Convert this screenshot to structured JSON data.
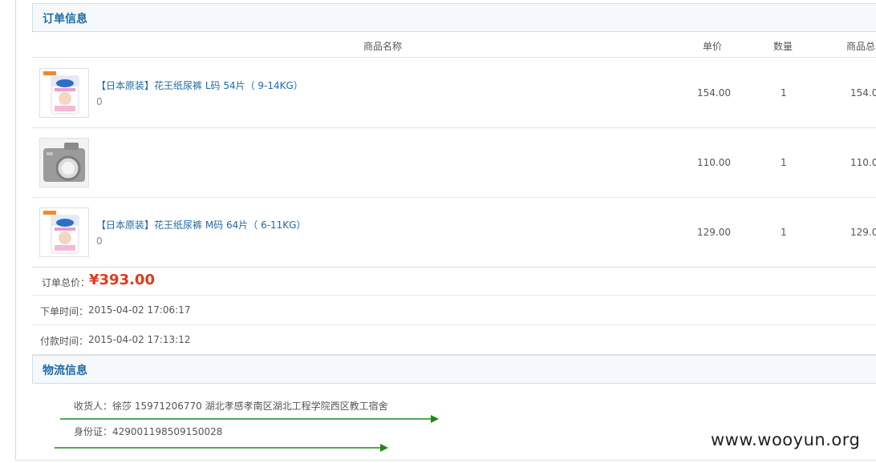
{
  "order_section": {
    "title": "订单信息"
  },
  "table_header": {
    "name": "商品名称",
    "price": "单价",
    "qty": "数量",
    "total": "商品总"
  },
  "items": [
    {
      "name": "【日本原装】花王纸尿裤 L码 54片（ 9-14KG）",
      "sub": "0",
      "price": "154.00",
      "qty": "1",
      "total": "154.0",
      "thumb": "diaper-package"
    },
    {
      "name": "",
      "sub": "",
      "price": "110.00",
      "qty": "1",
      "total": "110.0",
      "thumb": "camera-placeholder"
    },
    {
      "name": "【日本原装】花王纸尿裤 M码 64片（ 6-11KG）",
      "sub": "0",
      "price": "129.00",
      "qty": "1",
      "total": "129.0",
      "thumb": "diaper-package"
    }
  ],
  "summary": {
    "total_label": "订单总价：",
    "total_value": "¥393.00",
    "order_time_label": "下单时间：",
    "order_time": "2015-04-02 17:06:17",
    "pay_time_label": "付款时间：",
    "pay_time": "2015-04-02 17:13:12"
  },
  "logistics_section": {
    "title": "物流信息"
  },
  "logistics": {
    "recipient": "收货人：徐莎 15971206770 湖北孝感孝南区湖北工程学院西区教工宿舍",
    "id_card": "身份证：429001198509150028"
  },
  "watermark": "www.wooyun.org",
  "colors": {
    "link": "#1f6aa6",
    "price": "#e4391b",
    "arrow": "#1a8a1a"
  }
}
